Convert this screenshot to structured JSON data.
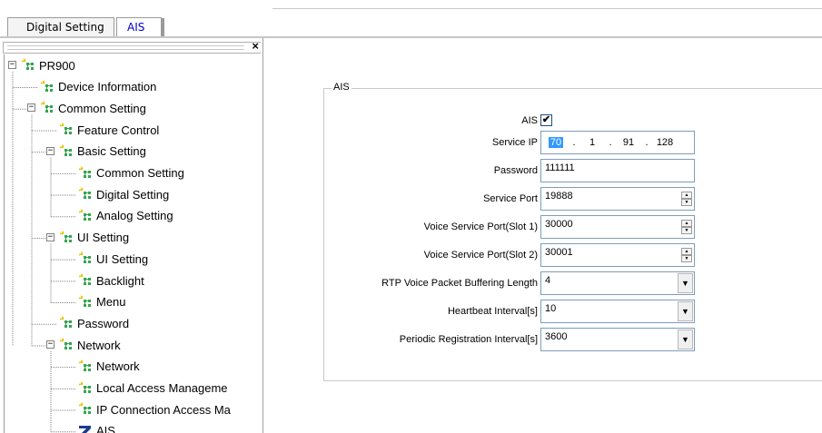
{
  "tabs": [
    {
      "label": "Digital Setting",
      "active": false
    },
    {
      "label": "AIS",
      "active": true
    }
  ],
  "panel": {
    "close_glyph": "×"
  },
  "tree": {
    "nodes": [
      {
        "label": "PR900"
      },
      {
        "label": "Device Information"
      },
      {
        "label": "Common Setting"
      },
      {
        "label": "Feature Control"
      },
      {
        "label": "Basic Setting"
      },
      {
        "label": "Common Setting"
      },
      {
        "label": "Digital Setting"
      },
      {
        "label": "Analog Setting"
      },
      {
        "label": "UI Setting"
      },
      {
        "label": "UI Setting"
      },
      {
        "label": "Backlight"
      },
      {
        "label": "Menu"
      },
      {
        "label": "Password"
      },
      {
        "label": "Network"
      },
      {
        "label": "Network"
      },
      {
        "label": "Local Access Manageme"
      },
      {
        "label": "IP Connection Access Ma"
      },
      {
        "label": "AIS"
      }
    ],
    "expander_minus": "−"
  },
  "form": {
    "group_title": "AIS",
    "ais_label": "AIS",
    "ais_checked": "✔",
    "service_ip_label": "Service IP",
    "service_ip": {
      "o1": "70",
      "o2": "1",
      "o3": "91",
      "o4": "128",
      "dot": "."
    },
    "password_label": "Password",
    "password_value": "111111",
    "service_port_label": "Service Port",
    "service_port_value": "19888",
    "voice_port1_label": "Voice Service Port(Slot 1)",
    "voice_port1_value": "30000",
    "voice_port2_label": "Voice Service Port(Slot 2)",
    "voice_port2_value": "30001",
    "rtp_label": "RTP Voice Packet Buffering Length",
    "rtp_value": "4",
    "heartbeat_label": "Heartbeat Interval[s]",
    "heartbeat_value": "10",
    "periodic_label": "Periodic Registration Interval[s]",
    "periodic_value": "3600",
    "spin_up": "▲",
    "spin_down": "▼",
    "combo_arrow": "▼"
  },
  "colors": {
    "ais_tab_text": "#0000c8",
    "ip_selection": "#3399ff",
    "icon_yellow": "#e6c200",
    "icon_green": "#33a64d",
    "ais_icon_blue": "#1a3c8c"
  }
}
